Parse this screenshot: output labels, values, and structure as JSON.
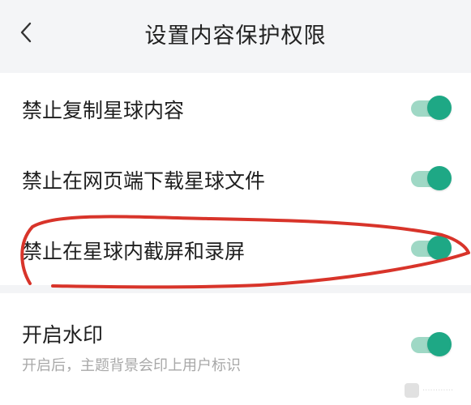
{
  "header": {
    "title": "设置内容保护权限",
    "back_icon": "chevron-left-icon"
  },
  "settings": [
    {
      "label": "禁止复制星球内容",
      "enabled": true
    },
    {
      "label": "禁止在网页端下载星球文件",
      "enabled": true
    },
    {
      "label": "禁止在星球内截屏和录屏",
      "enabled": true
    }
  ],
  "watermark_setting": {
    "label": "开启水印",
    "description": "开启后，主题背景会印上用户标识",
    "enabled": true
  },
  "colors": {
    "toggle_on": "#1ea885",
    "toggle_track": "#9fd8c5",
    "annotation": "#d8342a"
  }
}
